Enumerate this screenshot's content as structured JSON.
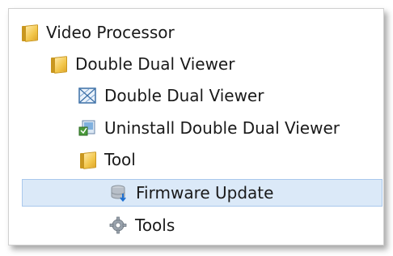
{
  "tree": {
    "items": [
      {
        "label": "Video Processor",
        "icon": "folder-icon"
      },
      {
        "label": "Double Dual Viewer",
        "icon": "folder-icon"
      },
      {
        "label": "Double Dual Viewer",
        "icon": "app-icon"
      },
      {
        "label": "Uninstall  Double Dual Viewer",
        "icon": "uninstall-icon"
      },
      {
        "label": "Tool",
        "icon": "folder-icon"
      },
      {
        "label": "Firmware Update",
        "icon": "firmware-update-icon",
        "selected": true
      },
      {
        "label": "Tools",
        "icon": "gear-icon"
      }
    ]
  },
  "colors": {
    "selection_bg": "#dbe9f8",
    "selection_border": "#a9c8ec",
    "folder": "#f2c64a"
  }
}
